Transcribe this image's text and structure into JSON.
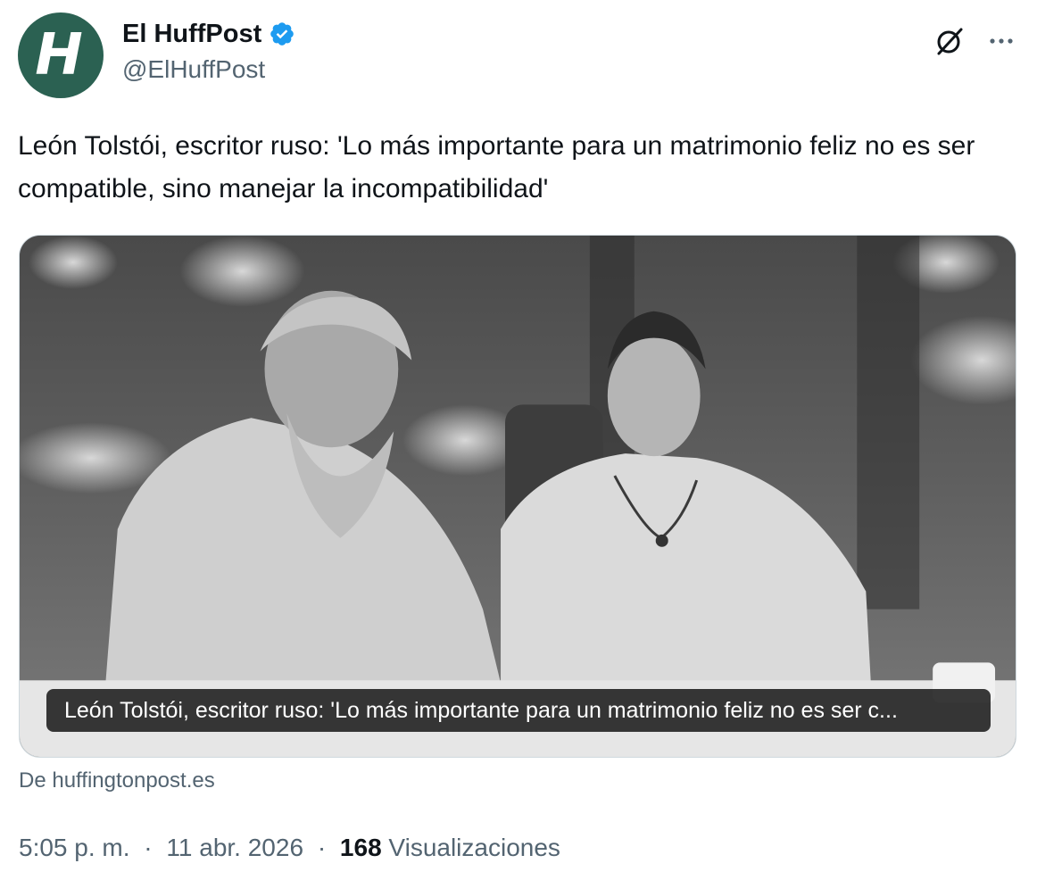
{
  "author": {
    "avatar_letter": "H",
    "display_name": "El HuffPost",
    "handle": "@ElHuffPost",
    "verified": true,
    "avatar_color": "#2b6152",
    "verified_color": "#1d9bf0"
  },
  "header_actions": {
    "grok_icon": "grok-icon",
    "more_icon": "more-horizontal-icon"
  },
  "tweet": {
    "text": "León Tolstói, escritor ruso: 'Lo más importante para un matrimonio feliz no es ser compatible, sino manejar la incompatibilidad'"
  },
  "link_card": {
    "caption": "León Tolstói, escritor ruso: 'Lo más importante para un matrimonio feliz no es ser c...",
    "source": "De huffingtonpost.es"
  },
  "meta": {
    "time": "5:05 p. m.",
    "separator": "·",
    "date": "11 abr. 2026",
    "views_count": "168",
    "views_label": "Visualizaciones"
  }
}
